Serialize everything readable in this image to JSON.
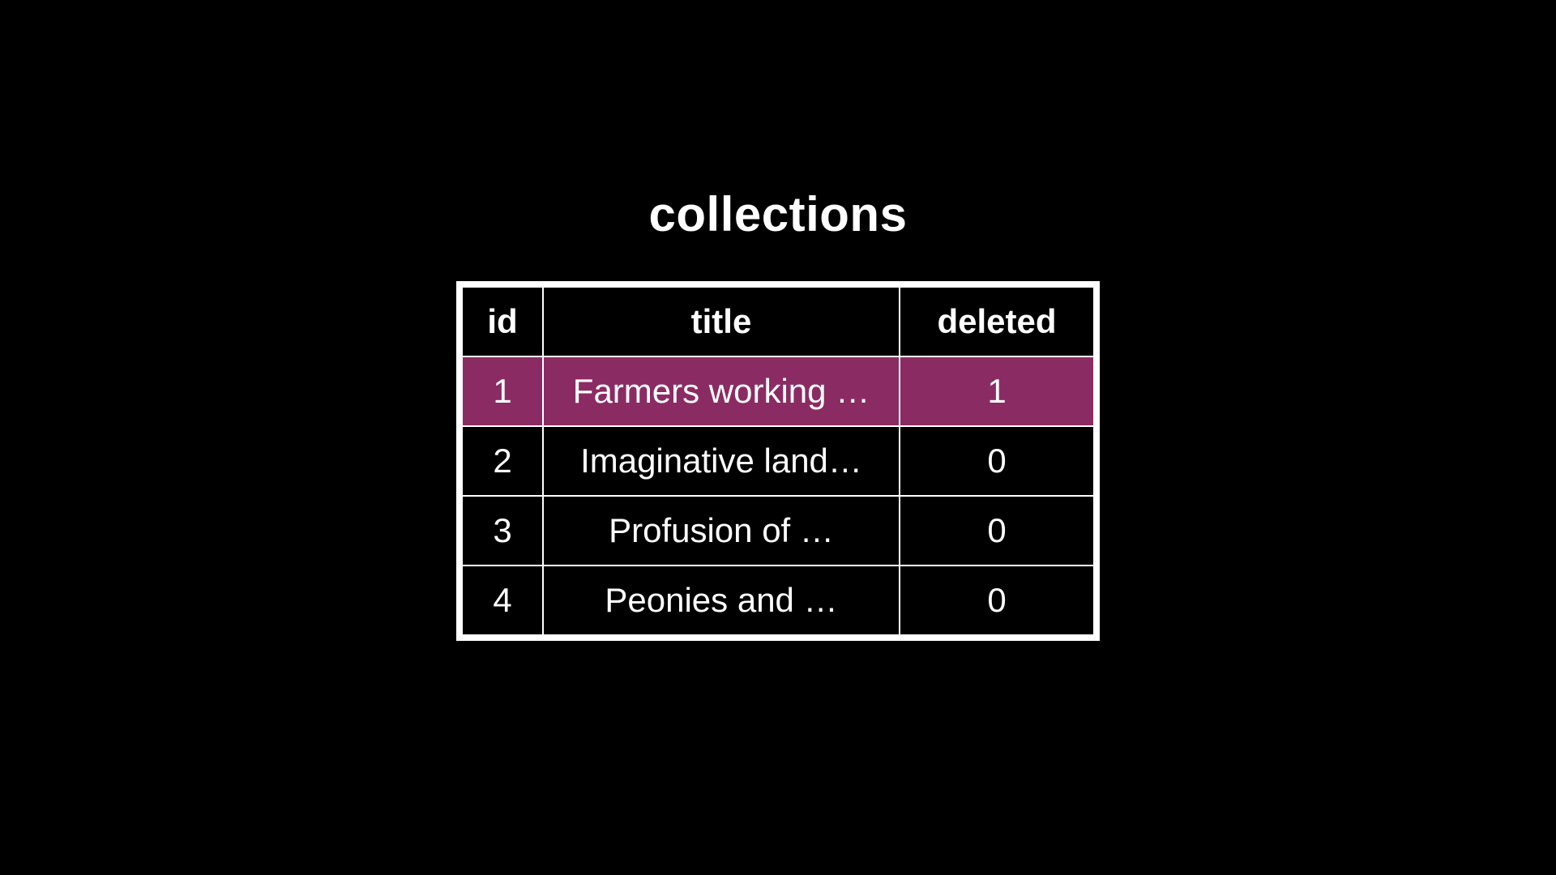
{
  "heading": "collections",
  "columns": {
    "id": "id",
    "title": "title",
    "deleted": "deleted"
  },
  "rows": [
    {
      "id": "1",
      "title": "Farmers working …",
      "deleted": "1",
      "highlight": true
    },
    {
      "id": "2",
      "title": "Imaginative land…",
      "deleted": "0",
      "highlight": false
    },
    {
      "id": "3",
      "title": "Profusion of …",
      "deleted": "0",
      "highlight": false
    },
    {
      "id": "4",
      "title": "Peonies and …",
      "deleted": "0",
      "highlight": false
    }
  ],
  "colors": {
    "highlight": "#8b2b63",
    "bg": "#000000",
    "fg": "#ffffff"
  }
}
